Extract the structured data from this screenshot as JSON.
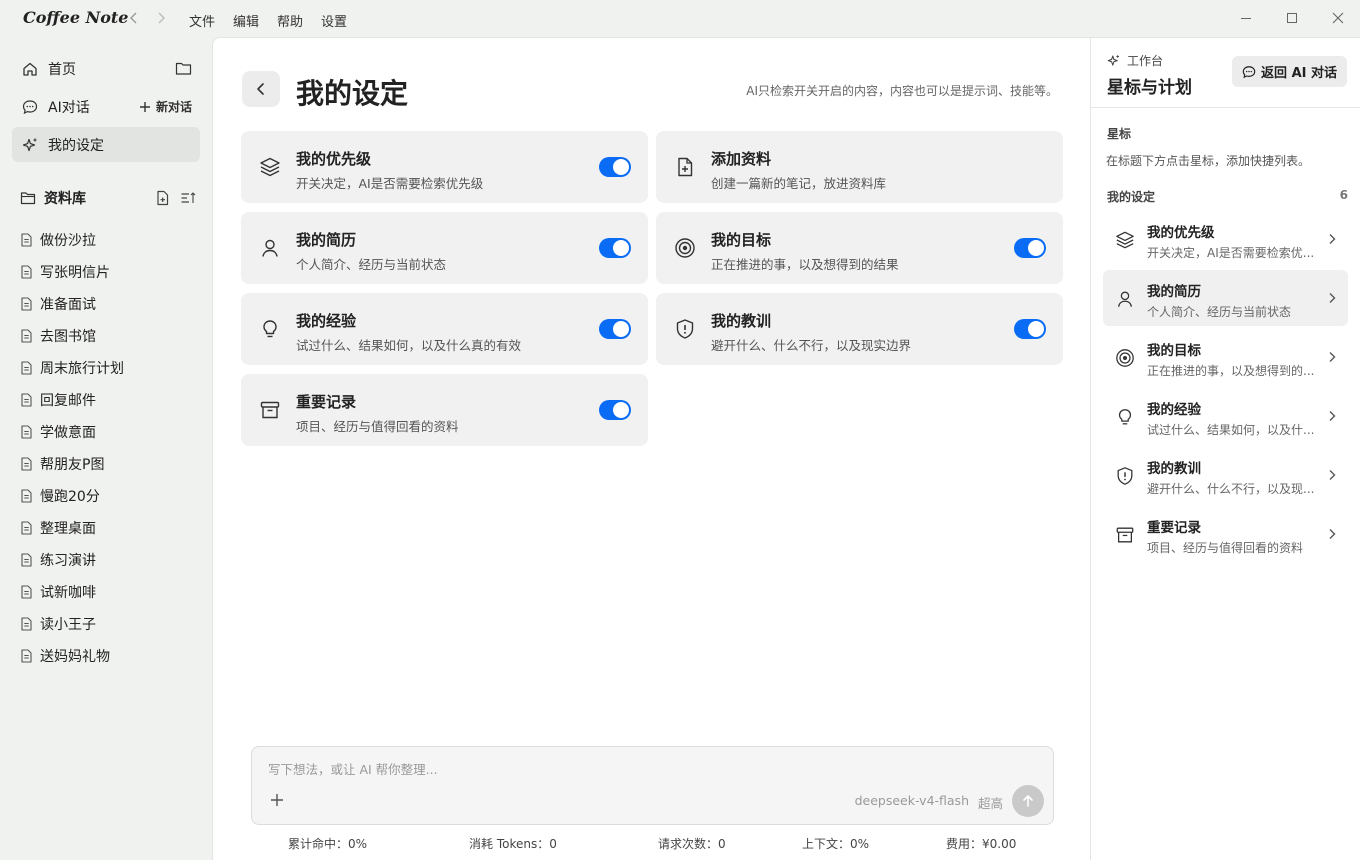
{
  "app": {
    "name": "Coffee Note"
  },
  "menu": [
    "文件",
    "编辑",
    "帮助",
    "设置"
  ],
  "sidebar": {
    "nav": [
      {
        "label": "首页",
        "icon": "home-icon"
      },
      {
        "label": "AI对话",
        "icon": "chat-icon",
        "action": "新对话"
      },
      {
        "label": "我的设定",
        "icon": "sparkle-icon"
      }
    ],
    "library": {
      "label": "资料库",
      "docs": [
        "做份沙拉",
        "写张明信片",
        "准备面试",
        "去图书馆",
        "周末旅行计划",
        "回复邮件",
        "学做意面",
        "帮朋友P图",
        "慢跑20分",
        "整理桌面",
        "练习演讲",
        "试新咖啡",
        "读小王子",
        "送妈妈礼物"
      ]
    }
  },
  "main": {
    "title": "我的设定",
    "hint": "AI只检索开关开启的内容，内容也可以是提示词、技能等。",
    "cards": [
      {
        "title": "我的优先级",
        "sub": "开关决定，AI是否需要检索优先级",
        "icon": "layers-icon",
        "toggle": true
      },
      {
        "title": "添加资料",
        "sub": "创建一篇新的笔记，放进资料库",
        "icon": "file-plus-icon",
        "toggle": false
      },
      {
        "title": "我的简历",
        "sub": "个人简介、经历与当前状态",
        "icon": "user-icon",
        "toggle": true
      },
      {
        "title": "我的目标",
        "sub": "正在推进的事，以及想得到的结果",
        "icon": "target-icon",
        "toggle": true
      },
      {
        "title": "我的经验",
        "sub": "试过什么、结果如何，以及什么真的有效",
        "icon": "bulb-icon",
        "toggle": true
      },
      {
        "title": "我的教训",
        "sub": "避开什么、什么不行，以及现实边界",
        "icon": "shield-alert-icon",
        "toggle": true
      },
      {
        "title": "重要记录",
        "sub": "项目、经历与值得回看的资料",
        "icon": "archive-icon",
        "toggle": true
      }
    ],
    "composer": {
      "placeholder": "写下想法，或让 AI 帮你整理...",
      "model": "deepseek-v4-flash",
      "level": "超高"
    },
    "stats": [
      "累计命中：0%",
      "消耗 Tokens：0",
      "请求次数：0",
      "上下文：0%",
      "费用：¥0.00"
    ]
  },
  "right": {
    "kicker": "工作台",
    "title": "星标与计划",
    "back": "返回 AI 对话",
    "star_section": "星标",
    "star_desc": "在标题下方点击星标，添加快捷列表。",
    "settings_section": "我的设定",
    "settings_count": "6",
    "items": [
      {
        "title": "我的优先级",
        "sub": "开关决定，AI是否需要检索优...",
        "icon": "layers-icon"
      },
      {
        "title": "我的简历",
        "sub": "个人简介、经历与当前状态",
        "icon": "user-icon"
      },
      {
        "title": "我的目标",
        "sub": "正在推进的事，以及想得到的...",
        "icon": "target-icon"
      },
      {
        "title": "我的经验",
        "sub": "试过什么、结果如何，以及什...",
        "icon": "bulb-icon"
      },
      {
        "title": "我的教训",
        "sub": "避开什么、什么不行，以及现...",
        "icon": "shield-alert-icon"
      },
      {
        "title": "重要记录",
        "sub": "项目、经历与值得回看的资料",
        "icon": "archive-icon"
      }
    ]
  },
  "colors": {
    "accent": "#0a6cf5",
    "sidebar_bg": "#f0f2ef",
    "card_bg": "#f1f1f1"
  }
}
